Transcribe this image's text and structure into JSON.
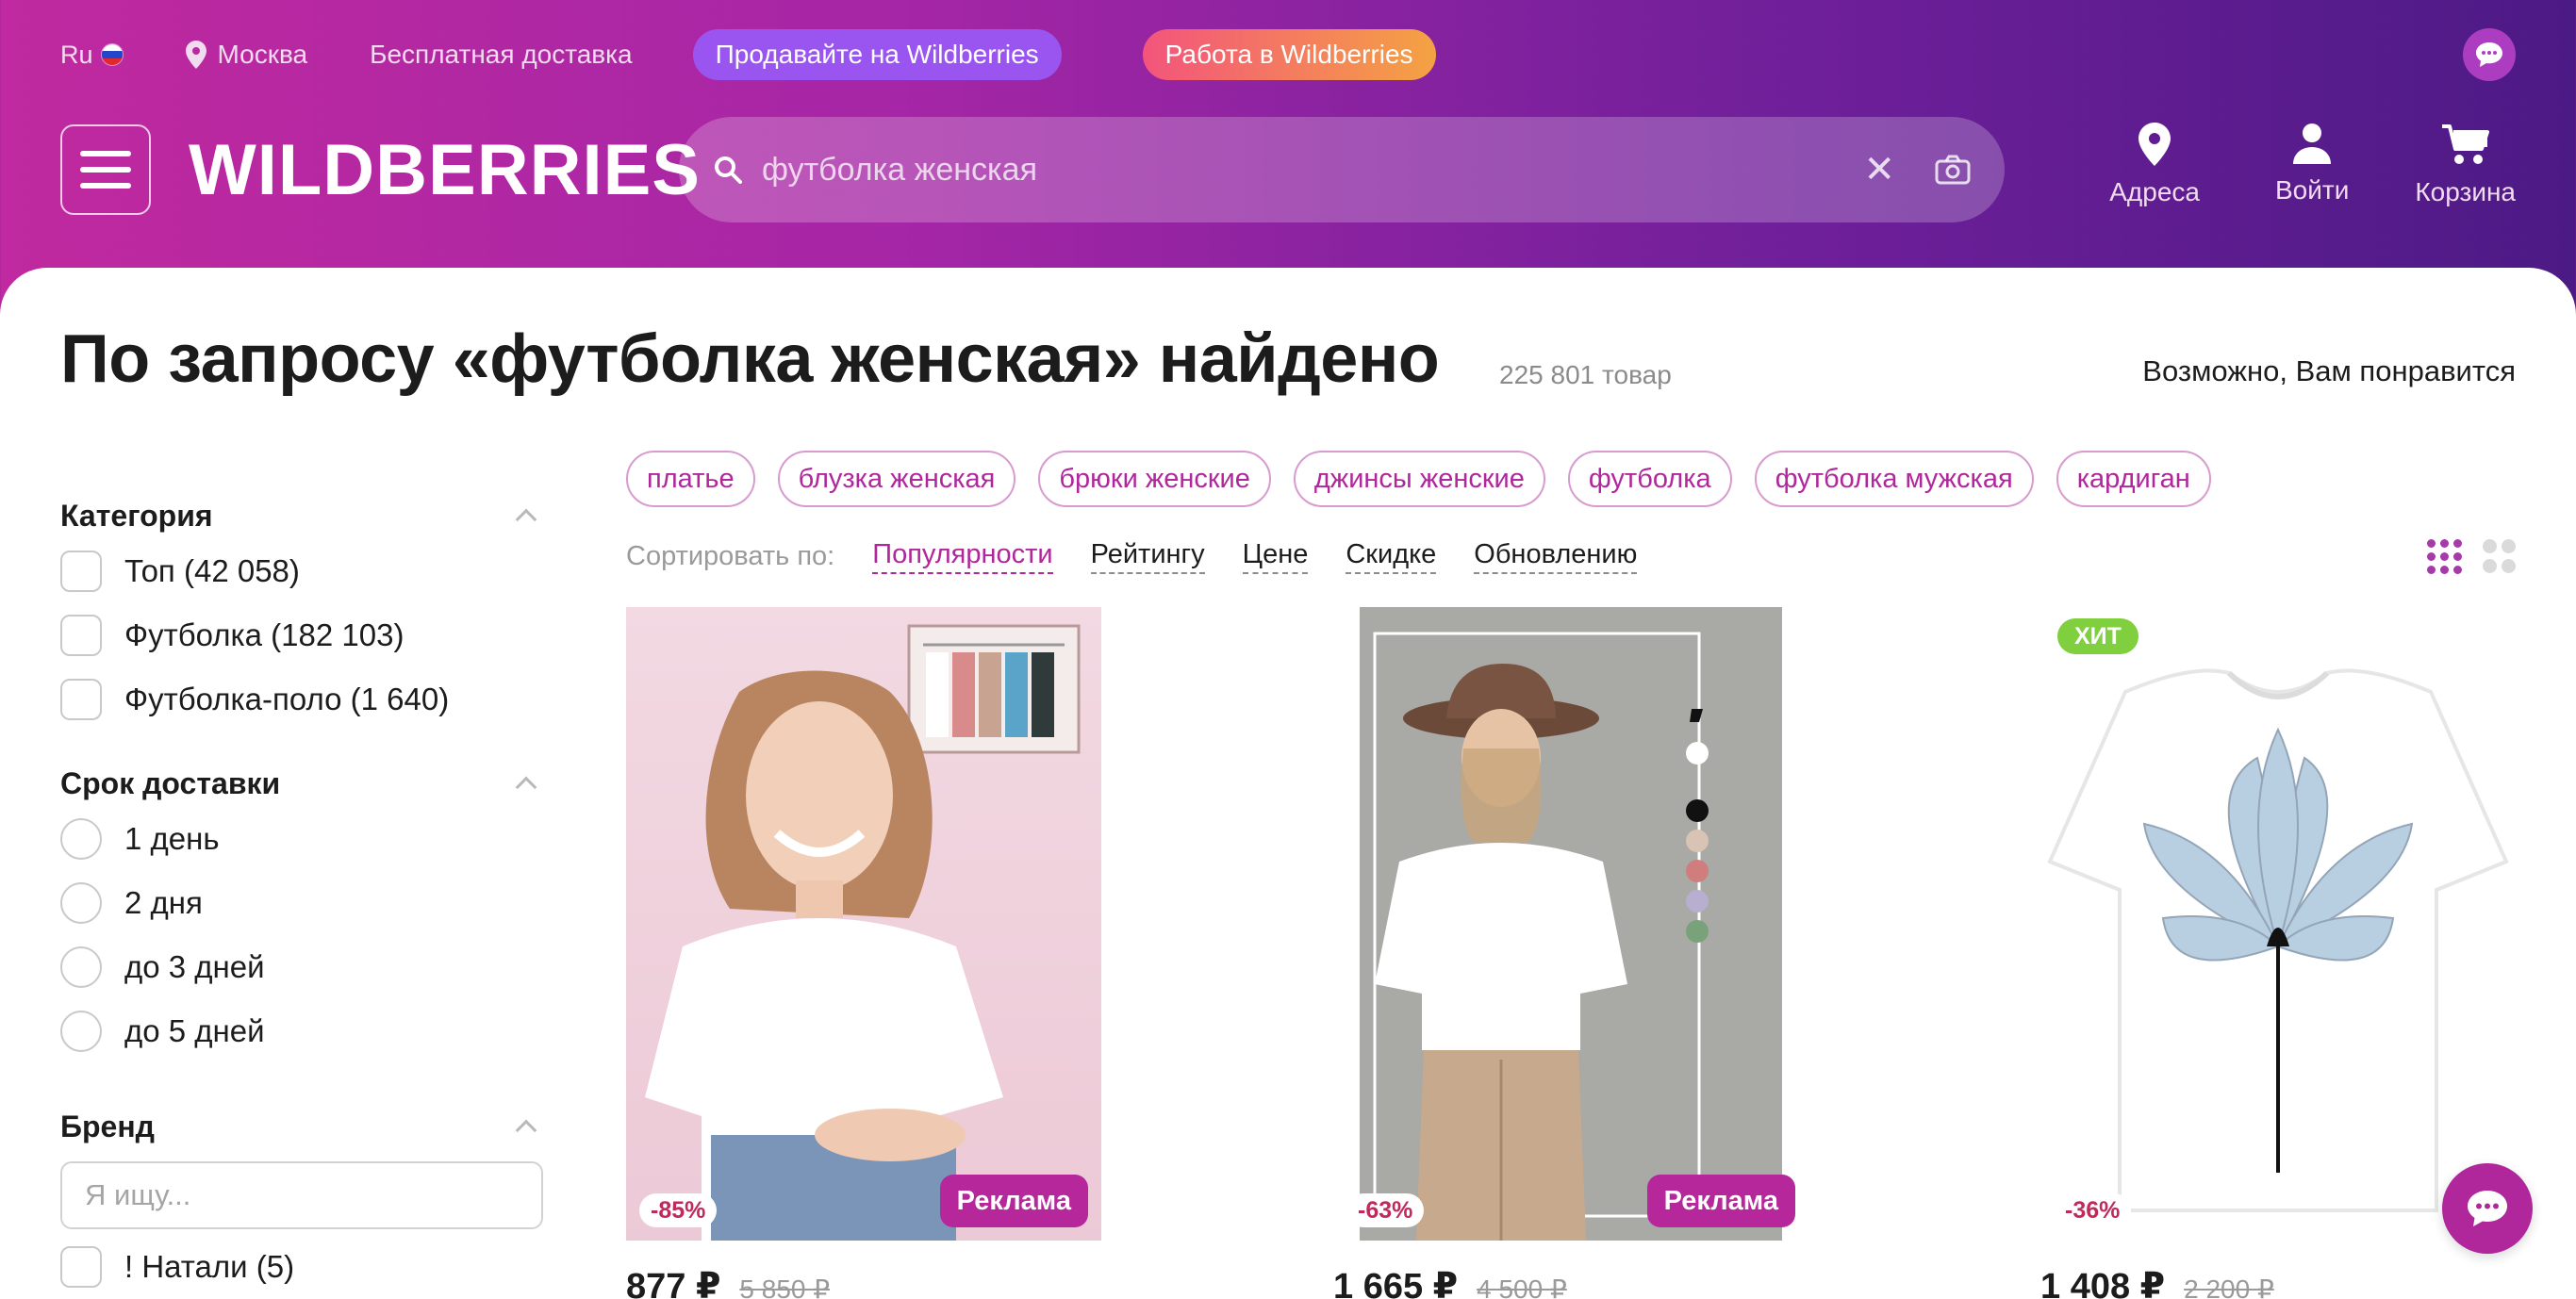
{
  "topbar": {
    "lang": "Ru",
    "city": "Москва",
    "delivery": "Бесплатная доставка",
    "sell": "Продавайте на Wildberries",
    "work": "Работа в Wildberries"
  },
  "header": {
    "logo": "WILDBERRIES",
    "search_value": "",
    "search_placeholder": "футболка женская",
    "clear": "✕",
    "addresses": "Адреса",
    "login": "Войти",
    "cart": "Корзина"
  },
  "results": {
    "title": "По запросу «футболка женская» найдено",
    "count": "225 801 товар",
    "maybe": "Возможно, Вам понравится"
  },
  "chips": [
    "платье",
    "блузка женская",
    "брюки женские",
    "джинсы женские",
    "футболка",
    "футболка мужская",
    "кардиган"
  ],
  "sort": {
    "label": "Сортировать по:",
    "options": [
      "Популярности",
      "Рейтингу",
      "Цене",
      "Скидке",
      "Обновлению"
    ]
  },
  "filters": {
    "category": {
      "title": "Категория",
      "options": [
        "Топ (42 058)",
        "Футболка (182 103)",
        "Футболка-поло (1 640)"
      ]
    },
    "delivery": {
      "title": "Срок доставки",
      "options": [
        "1 день",
        "2 дня",
        "до 3 дней",
        "до 5 дней"
      ]
    },
    "brand": {
      "title": "Бренд",
      "placeholder": "Я ищу...",
      "first": "! Натали (5)"
    }
  },
  "products": [
    {
      "discount": "-85%",
      "ad": "Реклама",
      "price": "877 ₽",
      "old_price": "5 850 ₽"
    },
    {
      "discount": "-63%",
      "ad": "Реклама",
      "price": "1 665 ₽",
      "old_price": "4 500 ₽"
    },
    {
      "discount": "-36%",
      "hit": "ХИТ",
      "price": "1 408 ₽",
      "old_price": "2 200 ₽"
    }
  ],
  "colors": {
    "accent": "#b0279c",
    "header_from": "#c0299f",
    "header_to": "#4c1a85"
  }
}
